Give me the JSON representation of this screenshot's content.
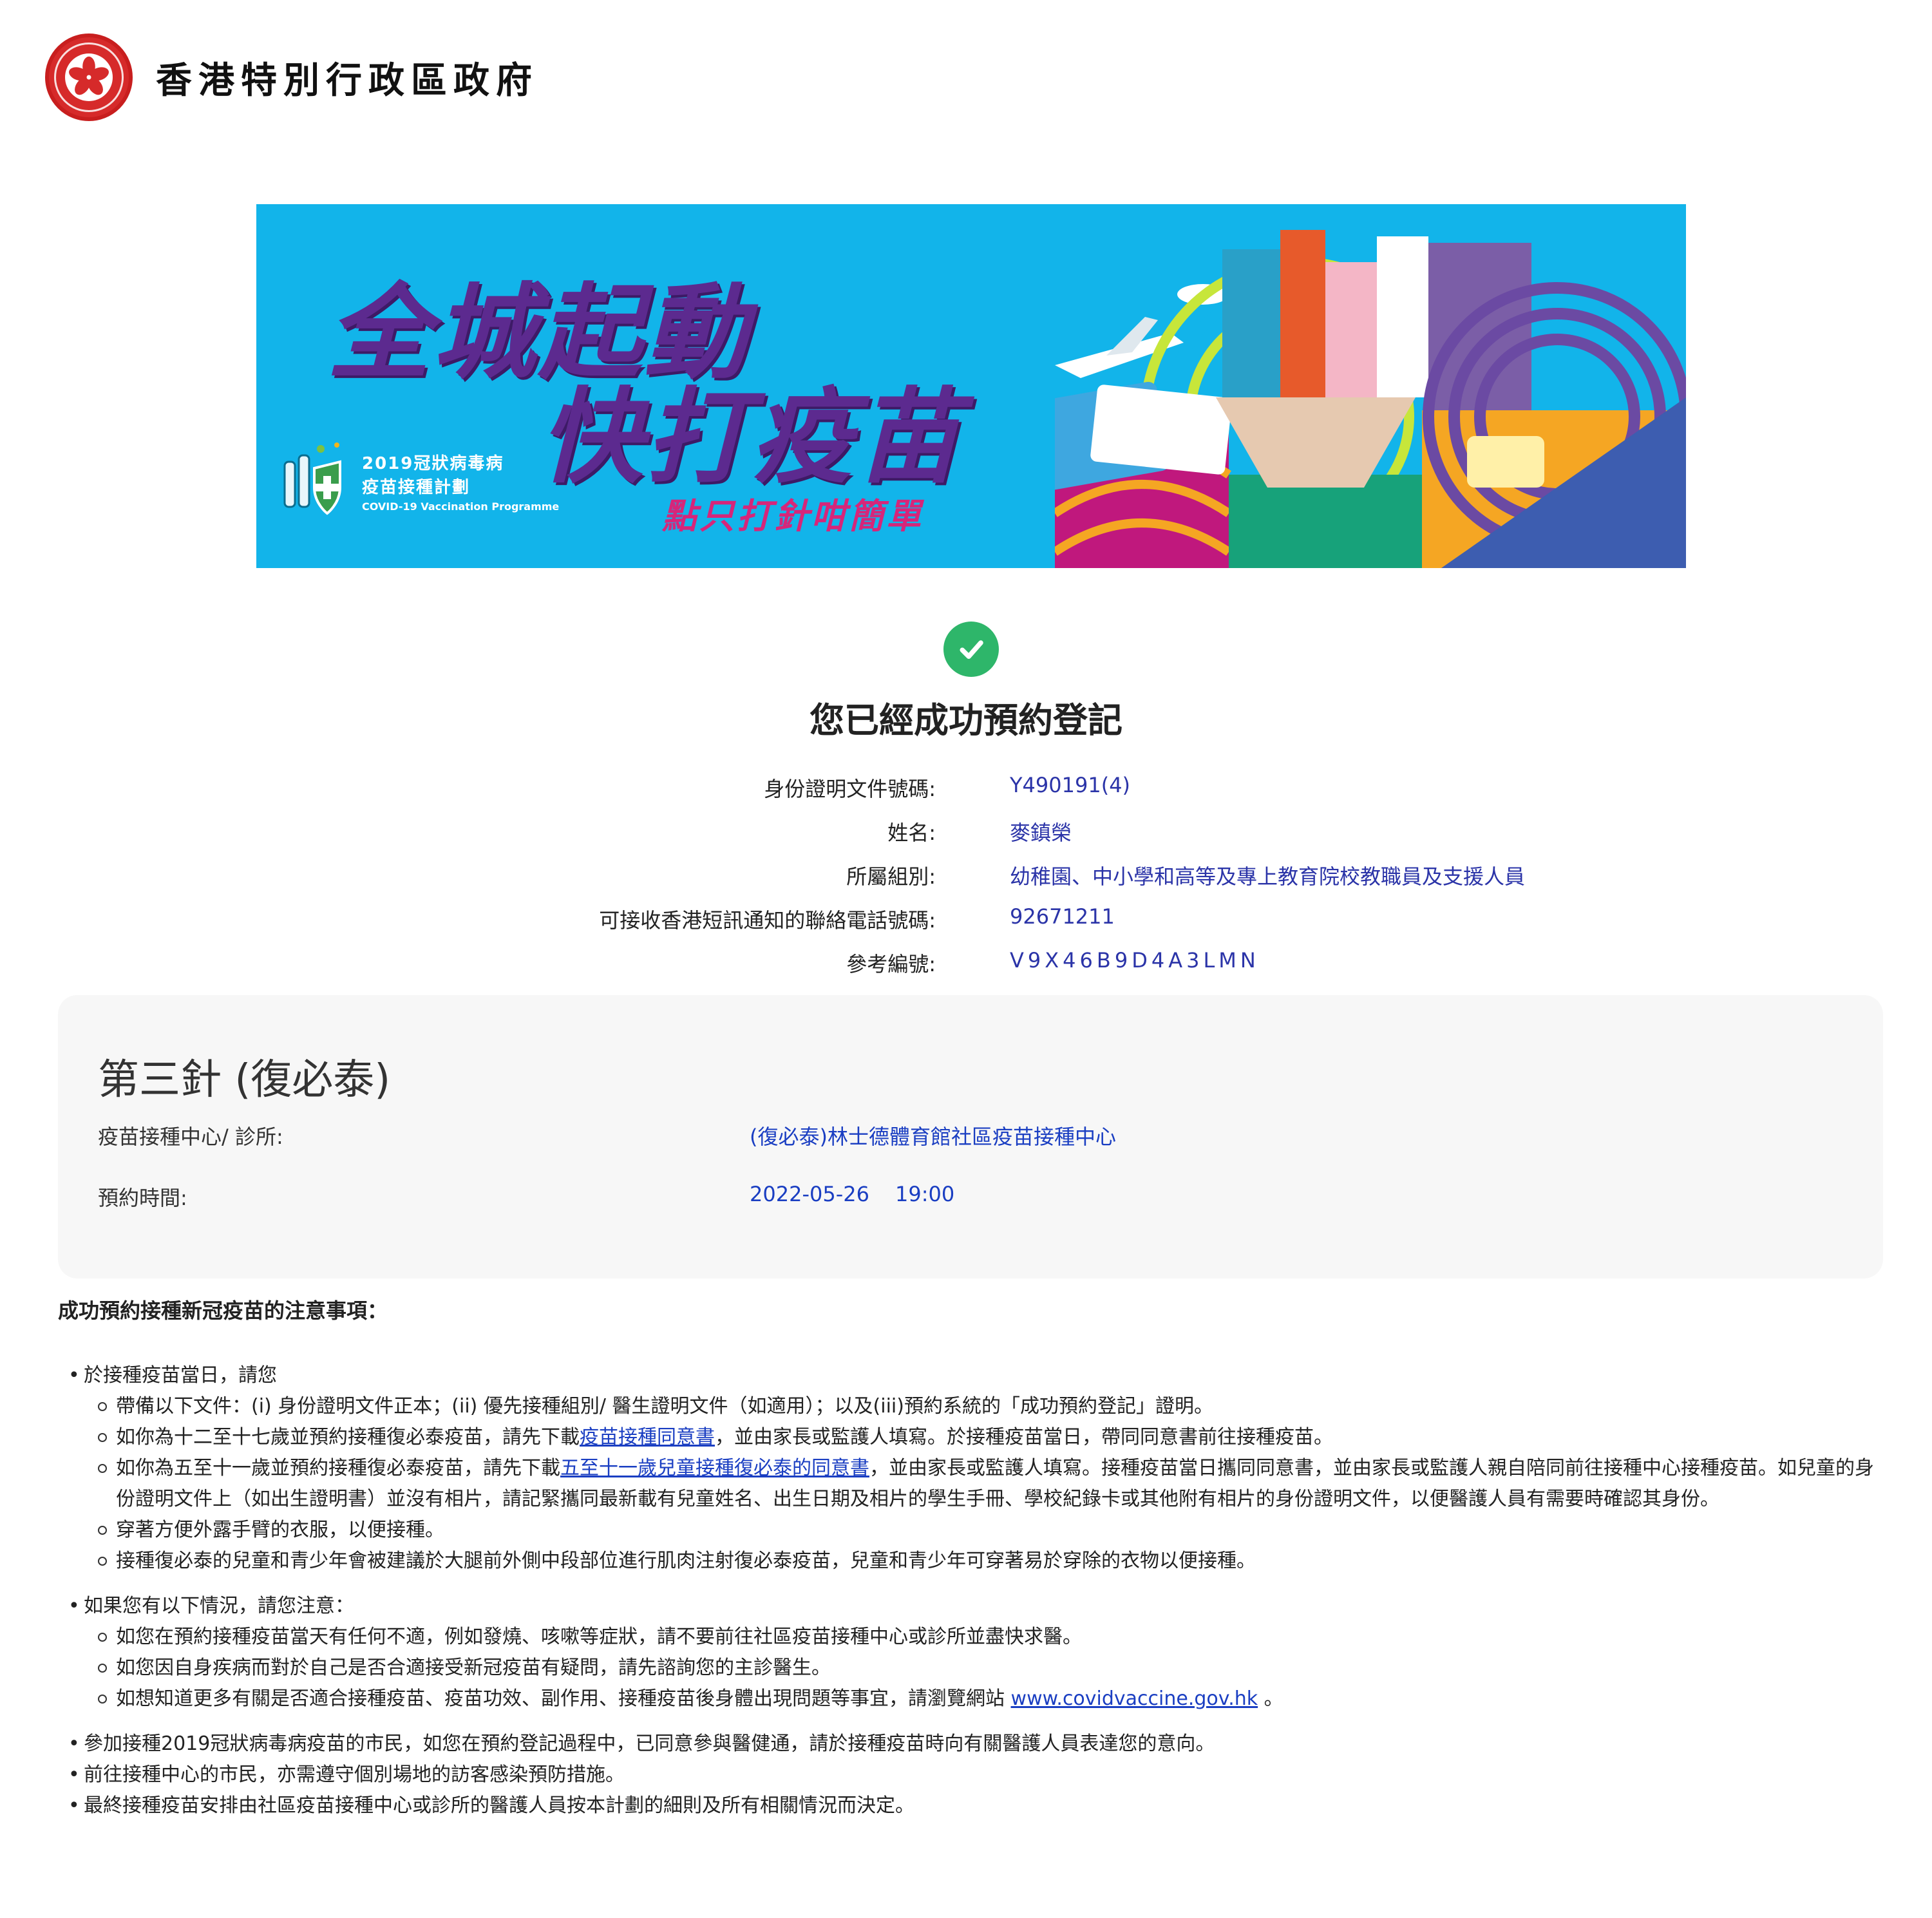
{
  "header": {
    "gov_title": "香港特別行政區政府",
    "emblem_icon": "hksar-bauhinia-emblem-icon",
    "emblem_color": "#d62a2a"
  },
  "banner": {
    "headline_1": "全城起動",
    "headline_2": "快打疫苗",
    "subline": "點只打針咁簡單",
    "programme_zh_1": "2019冠狀病毒病",
    "programme_zh_2": "疫苗接種計劃",
    "programme_en": "COVID-19 Vaccination Programme",
    "background_color": "#12b4ea",
    "headline_color": "#5c2a8f"
  },
  "success": {
    "icon": "check-circle-icon",
    "icon_color": "#2eb66a",
    "title": "您已經成功預約登記"
  },
  "info": {
    "rows": [
      {
        "label": "身份證明文件號碼:",
        "value": "Y490191(4)"
      },
      {
        "label": "姓名:",
        "value": "麥鎮榮"
      },
      {
        "label": "所屬組別:",
        "value": "幼稚園、中小學和高等及專上教育院校教職員及支援人員"
      },
      {
        "label": "可接收香港短訊通知的聯絡電話號碼:",
        "value": "92671211"
      },
      {
        "label": "參考編號:",
        "value": "V9X46B9D4A3LMN"
      }
    ],
    "value_color": "#2b34a8"
  },
  "dose": {
    "title": "第三針 (復必泰)",
    "centre_label": "疫苗接種中心/ 診所:",
    "centre_value": "(復必泰)林士德體育館社區疫苗接種中心",
    "time_label": "預約時間:",
    "date_value": "2022-05-26",
    "time_value": "19:00"
  },
  "notes": {
    "title": "成功預約接種新冠疫苗的注意事項：",
    "b1": "於接種疫苗當日，請您",
    "b1_s1": "帶備以下文件：(i) 身份證明文件正本；(ii) 優先接種組別/ 醫生證明文件（如適用）；以及(iii)預約系統的「成功預約登記」證明。",
    "b1_s2_pre": "如你為十二至十七歲並預約接種復必泰疫苗，請先下載",
    "b1_s2_link": "疫苗接種同意書",
    "b1_s2_post": "，並由家長或監護人填寫。於接種疫苗當日，帶同同意書前往接種疫苗。",
    "b1_s3_pre": "如你為五至十一歲並預約接種復必泰疫苗，請先下載",
    "b1_s3_link": "五至十一歲兒童接種復必泰的同意書",
    "b1_s3_post": "，並由家長或監護人填寫。接種疫苗當日攜同同意書，並由家長或監護人親自陪同前往接種中心接種疫苗。如兒童的身份證明文件上（如出生證明書）並沒有相片，請記緊攜同最新載有兒童姓名、出生日期及相片的學生手冊、學校紀錄卡或其他附有相片的身份證明文件，以便醫護人員有需要時確認其身份。",
    "b1_s4": "穿著方便外露手臂的衣服，以便接種。",
    "b1_s5": "接種復必泰的兒童和青少年會被建議於大腿前外側中段部位進行肌肉注射復必泰疫苗，兒童和青少年可穿著易於穿除的衣物以便接種。",
    "b2": "如果您有以下情況，請您注意：",
    "b2_s1": "如您在預約接種疫苗當天有任何不適，例如發燒、咳嗽等症狀，請不要前往社區疫苗接種中心或診所並盡快求醫。",
    "b2_s2": "如您因自身疾病而對於自己是否合適接受新冠疫苗有疑問，請先諮詢您的主診醫生。",
    "b2_s3_pre": "如想知道更多有關是否適合接種疫苗、疫苗功效、副作用、接種疫苗後身體出現問題等事宜，請瀏覽網站 ",
    "b2_s3_link": "www.covidvaccine.gov.hk",
    "b2_s3_post": " 。",
    "b3": "參加接種2019冠狀病毒病疫苗的市民，如您在預約登記過程中，已同意參與醫健通，請於接種疫苗時向有關醫護人員表達您的意向。",
    "b4": "前往接種中心的市民，亦需遵守個別場地的訪客感染預防措施。",
    "b5": "最終接種疫苗安排由社區疫苗接種中心或診所的醫護人員按本計劃的細則及所有相關情況而決定。",
    "link_color": "#1a3ec2"
  }
}
